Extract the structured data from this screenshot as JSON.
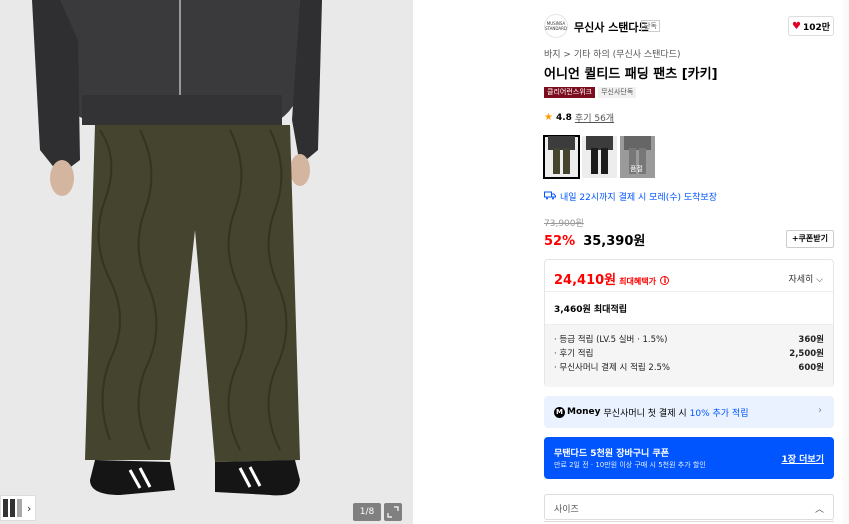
{
  "image": {
    "counter": "1/8"
  },
  "brand": {
    "logo_text": "MUSINSA STANDARD",
    "name": "무신사 스탠다드",
    "tag": "단독",
    "likes": "102만"
  },
  "product": {
    "breadcrumb": "바지 > 기타 하의 (무신사 스탠다드)",
    "title": "어니언 퀼티드 패딩 팬츠 [카키]",
    "badges": [
      "클리어런스위크",
      "무신사단독"
    ],
    "rating": "4.8",
    "reviews": "후기 56개",
    "swatch_sold_label": "품절",
    "delivery": "내일 22시까지 결제 시 모레(수) 도착보장"
  },
  "price": {
    "original": "73,900원",
    "discount": "52%",
    "current": "35,390원",
    "coupon_button": "+쿠폰받기"
  },
  "benefit": {
    "best_price": "24,410원",
    "best_label": "최대혜택가",
    "info_icon": "ⓘ",
    "detail_label": "자세히",
    "points_max": "3,460원 최대적립",
    "rows": [
      {
        "label": "· 등급 적립 (LV.5 실버 · 1.5%)",
        "value": "360원"
      },
      {
        "label": "· 후기 적립",
        "value": "2,500원"
      },
      {
        "label": "· 무신사머니 결제 시 적립 2.5%",
        "value": "600원"
      }
    ]
  },
  "money_banner": {
    "logo": "M",
    "word": "Money",
    "text": "무신사머니 첫 결제 시",
    "highlight": "10% 추가 적립"
  },
  "coupon_banner": {
    "title": "무탠다드 5천원 장바구니 쿠폰",
    "subtitle": "만료 2일 전 · 10만원 이상 구매 시 5천원 추가 할인",
    "more": "1장 더보기"
  },
  "options": {
    "size_label": "사이즈"
  },
  "colors": {
    "accent_red": "#ff0000",
    "accent_blue": "#0055ff",
    "badge_red": "#7b0d1e"
  }
}
